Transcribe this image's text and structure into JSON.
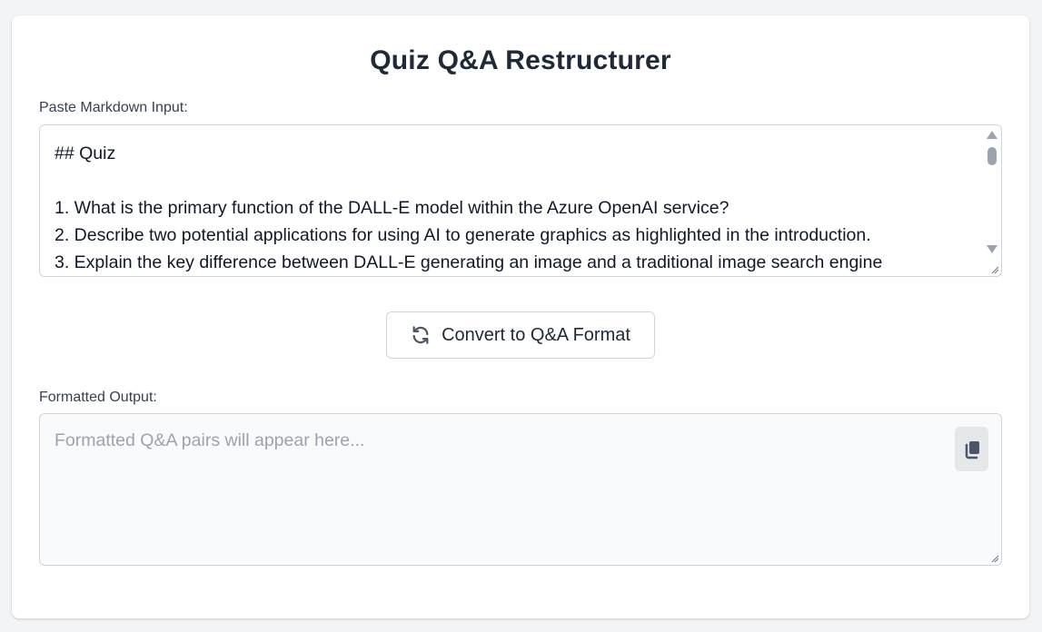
{
  "app": {
    "title": "Quiz Q&A Restructurer"
  },
  "input": {
    "label": "Paste Markdown Input:",
    "value": "## Quiz\n\n1. What is the primary function of the DALL-E model within the Azure OpenAI service?\n2. Describe two potential applications for using AI to generate graphics as highlighted in the introduction.\n3. Explain the key difference between DALL-E generating an image and a traditional image search engine"
  },
  "convert_button": {
    "label": "Convert to Q&A Format",
    "icon": "refresh-icon"
  },
  "output": {
    "label": "Formatted Output:",
    "placeholder": "Formatted Q&A pairs will appear here...",
    "value": "",
    "copy_icon": "copy-icon"
  },
  "colors": {
    "background": "#f3f4f6",
    "card": "#ffffff",
    "title": "#1f2937",
    "border": "#d1d5db",
    "output_bg": "#f9fafb",
    "placeholder": "#9ca3af",
    "copy_button_bg": "#e5e7eb"
  }
}
